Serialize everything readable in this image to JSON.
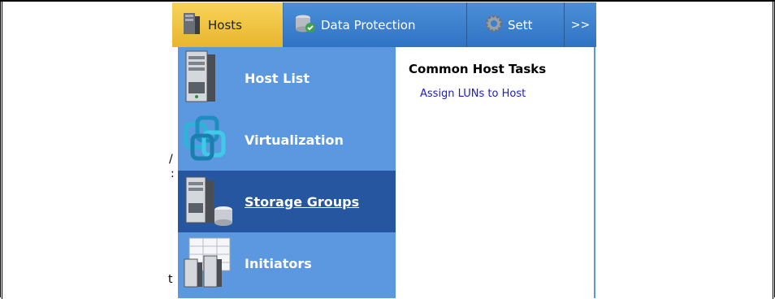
{
  "nav": {
    "tabs": [
      {
        "label": "Hosts",
        "icon": "server-icon",
        "active": true
      },
      {
        "label": "Data Protection",
        "icon": "database-shield-icon"
      },
      {
        "label": "Sett",
        "icon": "gear-icon"
      },
      {
        "label": ">>",
        "icon": "more-icon"
      }
    ]
  },
  "menu": {
    "items": [
      {
        "label": "Host List",
        "icon": "server-tower-icon"
      },
      {
        "label": "Virtualization",
        "icon": "virtualization-rings-icon"
      },
      {
        "label": "Storage Groups",
        "icon": "server-storage-icon",
        "active": true
      },
      {
        "label": "Initiators",
        "icon": "initiators-grid-icon"
      }
    ]
  },
  "tasks": {
    "title": "Common Host Tasks",
    "links": [
      "Assign LUNs to Host"
    ]
  },
  "background_text": {
    "stub1": "/",
    "stub2": ":",
    "stub3": "t"
  },
  "colors": {
    "nav_blue": "#3a7fd0",
    "active_tab": "#f0c845",
    "menu_blue": "#5b98df",
    "menu_active": "#2656a0",
    "link": "#1a1ad0"
  }
}
